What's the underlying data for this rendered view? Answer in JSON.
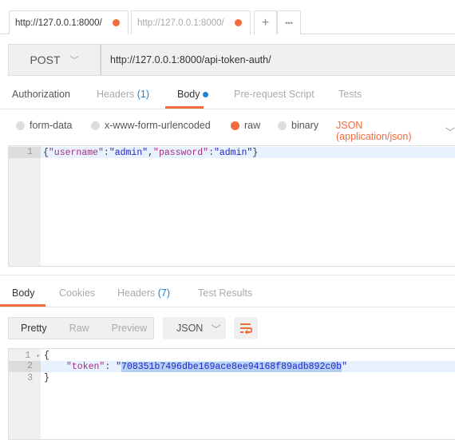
{
  "tabs": [
    {
      "label": "http://127.0.0.1:8000/",
      "active": true
    },
    {
      "label": "http://127.0.0.1:8000/",
      "active": false
    }
  ],
  "tab_actions": {
    "add": "+",
    "more": "•••"
  },
  "request": {
    "method": "POST",
    "url": "http://127.0.0.1:8000/api-token-auth/"
  },
  "request_tabs": {
    "authorization": "Authorization",
    "headers": "Headers",
    "headers_count": "(1)",
    "body": "Body",
    "prerequest": "Pre-request Script",
    "tests": "Tests"
  },
  "body_types": {
    "form_data": "form-data",
    "urlencoded": "x-www-form-urlencoded",
    "raw": "raw",
    "binary": "binary",
    "selected": "raw",
    "content_type": "JSON (application/json)"
  },
  "request_body": {
    "line": "1",
    "k1": "\"username\"",
    "v1": "\"admin\"",
    "k2": "\"password\"",
    "v2": "\"admin\""
  },
  "response_tabs": {
    "body": "Body",
    "cookies": "Cookies",
    "headers": "Headers",
    "headers_count": "(7)",
    "test_results": "Test Results"
  },
  "view_modes": {
    "pretty": "Pretty",
    "raw": "Raw",
    "preview": "Preview",
    "format": "JSON"
  },
  "response_body": {
    "lines": [
      "1",
      "2",
      "3"
    ],
    "key": "\"token\"",
    "token": "708351b7496dbe169ace8ee94168f89adb892c0b"
  },
  "colors": {
    "accent": "#f26b3a",
    "link": "#1f82d4"
  }
}
